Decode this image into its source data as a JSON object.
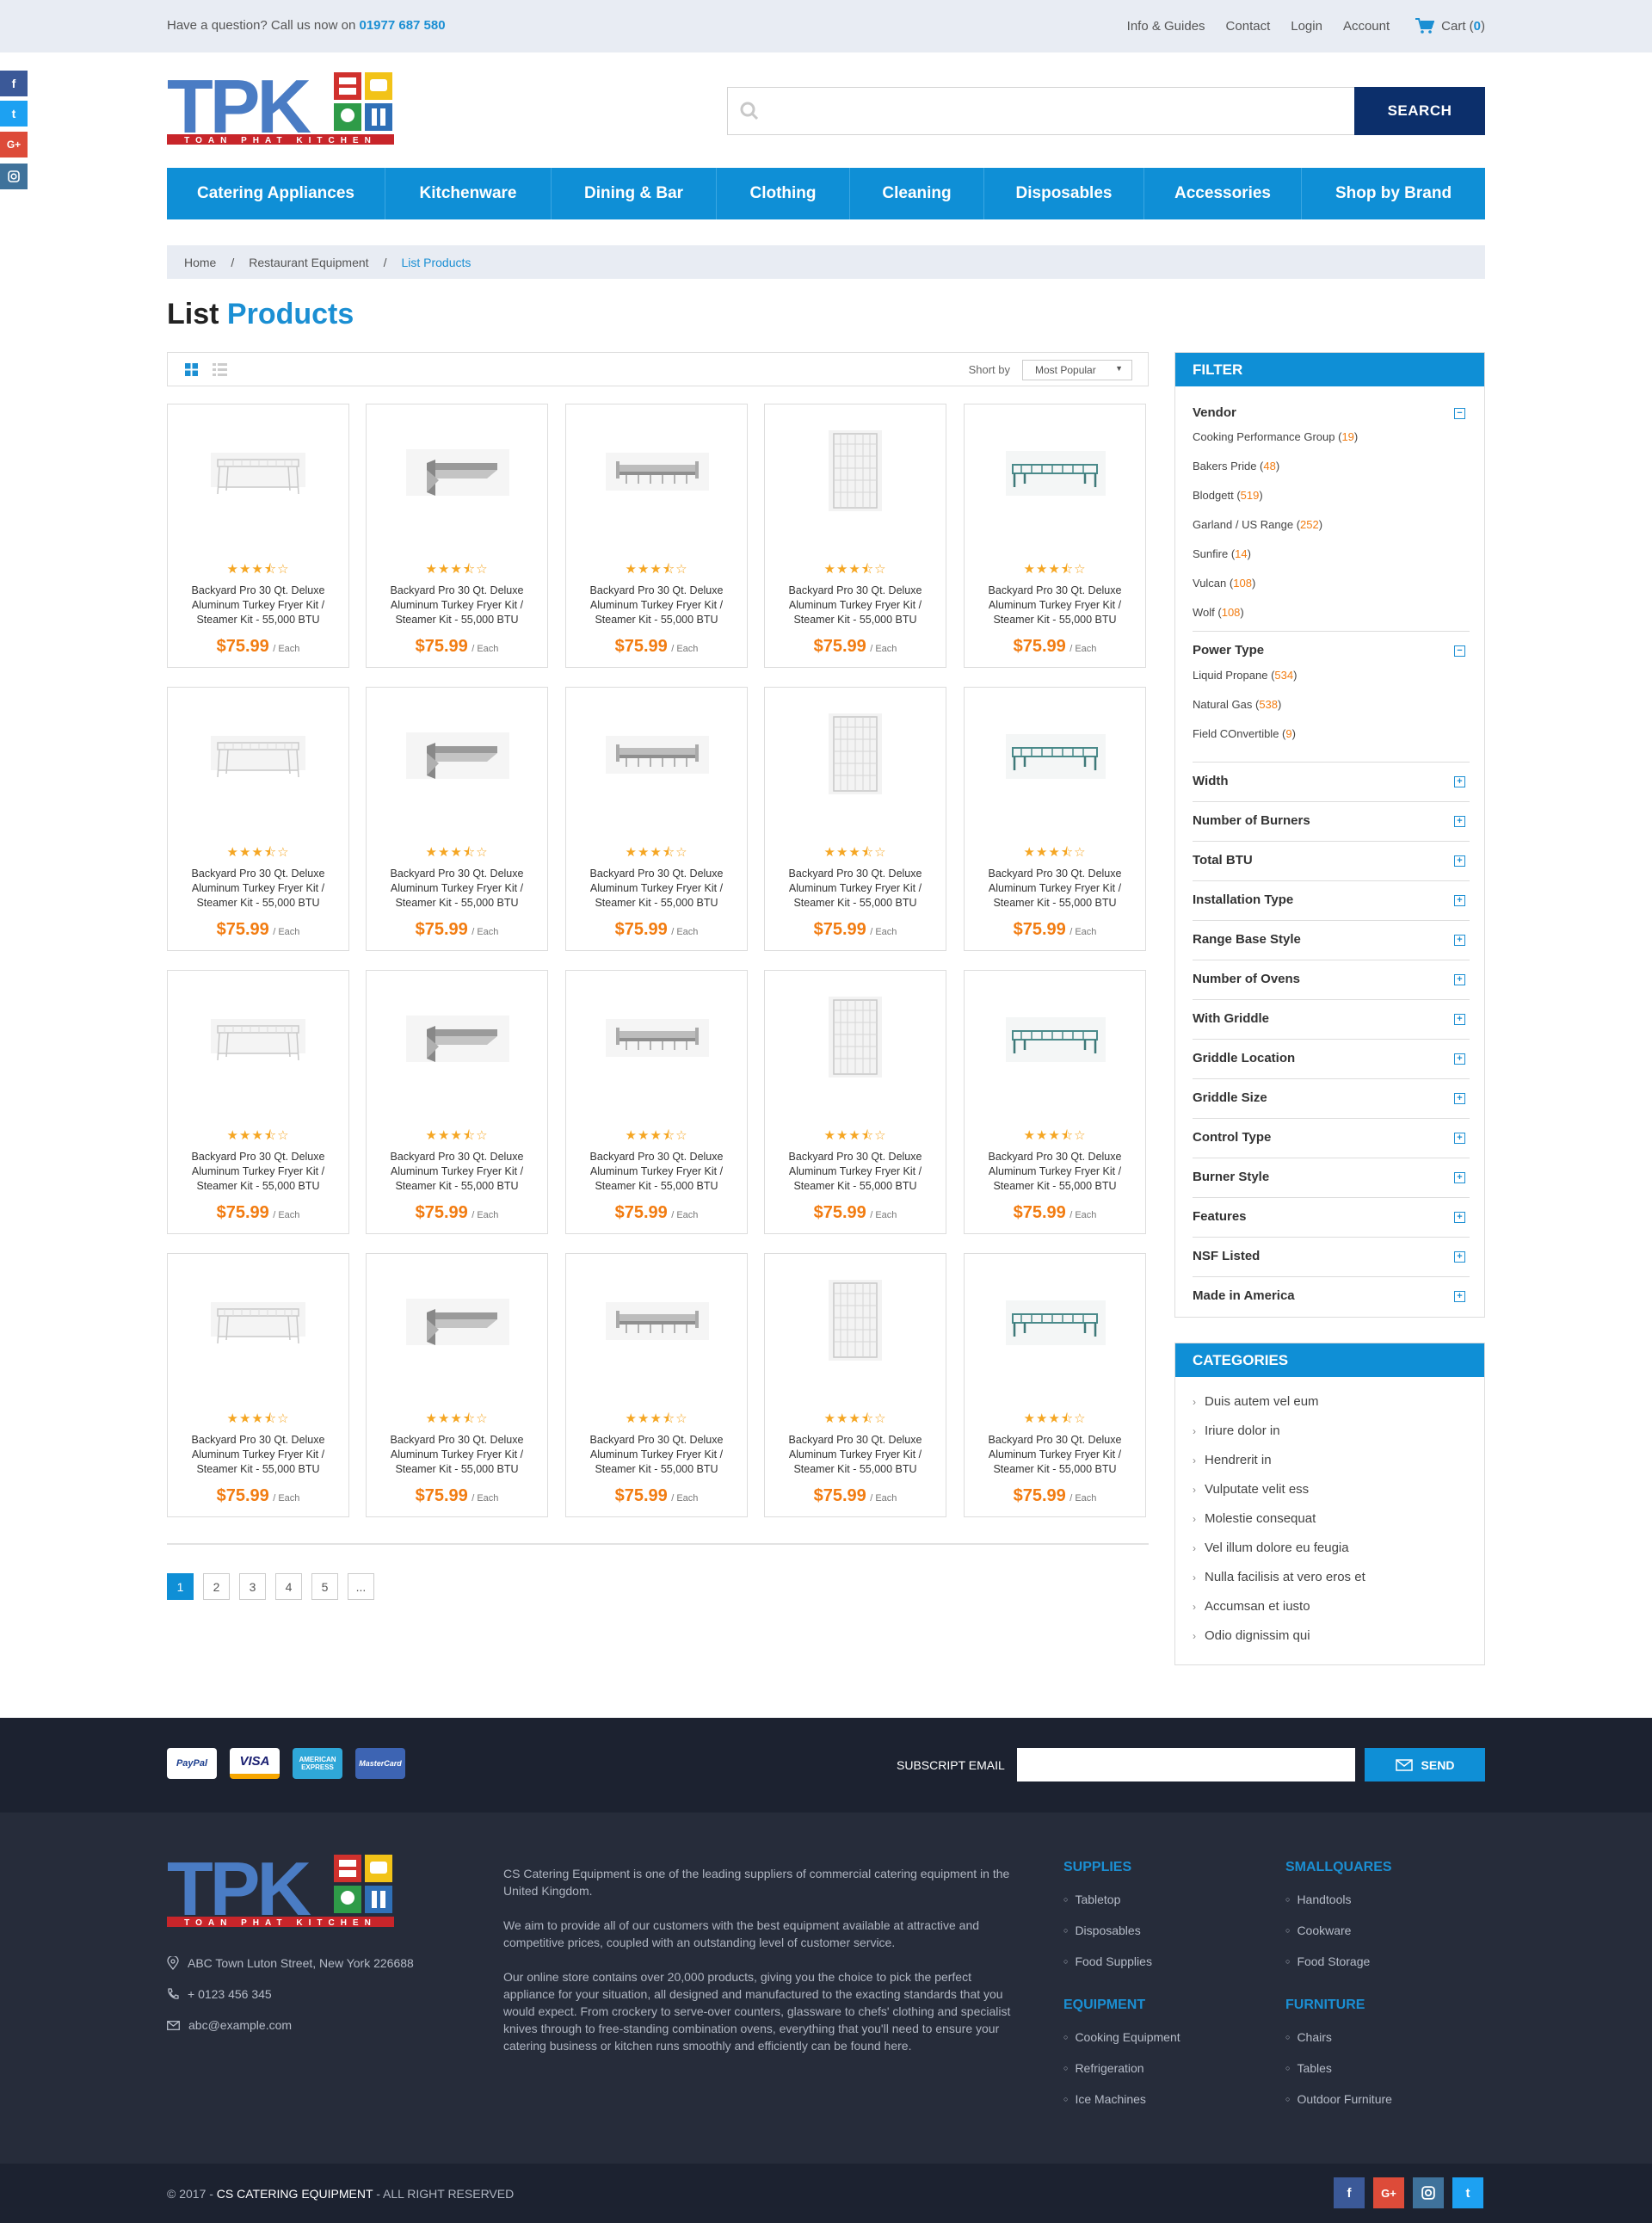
{
  "topbar": {
    "question": "Have a question? Call us now on",
    "phone": "01977 687 580",
    "links": [
      "Info & Guides",
      "Contact",
      "Login",
      "Account"
    ],
    "cart_label": "Cart (",
    "cart_count": "0",
    "cart_close": ")"
  },
  "logo": {
    "text": "TPK",
    "tagline": "TOAN PHAT KITCHEN"
  },
  "search": {
    "placeholder": "",
    "button": "SEARCH"
  },
  "nav": [
    "Catering Appliances",
    "Kitchenware",
    "Dining & Bar",
    "Clothing",
    "Cleaning",
    "Disposables",
    "Accessories",
    "Shop by Brand"
  ],
  "breadcrumb": [
    "Home",
    "Restaurant Equipment",
    "List Products"
  ],
  "page_title": {
    "first": "List",
    "second": "Products"
  },
  "toolbar": {
    "sort_label": "Short by",
    "sort_value": "Most Popular"
  },
  "product": {
    "name": "Backyard Pro 30 Qt. Deluxe Aluminum Turkey Fryer Kit / Steamer Kit - 55,000 BTU",
    "price": "$75.99",
    "unit": "/ Each",
    "rating": 3.5,
    "rating_max": 5
  },
  "pagination": [
    "1",
    "2",
    "3",
    "4",
    "5",
    "..."
  ],
  "filter": {
    "title": "FILTER",
    "vendor": {
      "title": "Vendor",
      "options": [
        {
          "label": "Cooking Performance Group",
          "count": "19"
        },
        {
          "label": "Bakers Pride",
          "count": "48"
        },
        {
          "label": "Blodgett",
          "count": "519"
        },
        {
          "label": "Garland / US Range",
          "count": "252"
        },
        {
          "label": "Sunfire",
          "count": "14"
        },
        {
          "label": "Vulcan",
          "count": "108"
        },
        {
          "label": "Wolf",
          "count": "108"
        }
      ]
    },
    "power": {
      "title": "Power Type",
      "options": [
        {
          "label": "Liquid Propane",
          "count": "534"
        },
        {
          "label": "Natural Gas",
          "count": "538"
        },
        {
          "label": "Field COnvertible",
          "count": "9"
        }
      ]
    },
    "collapsed": [
      "Width",
      "Number of Burners",
      "Total BTU",
      "Installation Type",
      "Range Base Style",
      "Number of Ovens",
      "With Griddle",
      "Griddle Location",
      "Griddle Size",
      "Control Type",
      "Burner Style",
      "Features",
      "NSF Listed",
      "Made in America"
    ]
  },
  "categories": {
    "title": "CATEGORIES",
    "items": [
      "Duis autem vel eum",
      "Iriure dolor in",
      "Hendrerit in",
      "Vulputate velit ess",
      "Molestie consequat",
      "Vel illum dolore eu feugia",
      "Nulla facilisis at vero eros et",
      "Accumsan et iusto",
      "Odio dignissim qui"
    ]
  },
  "payments": [
    "PayPal",
    "VISA",
    "AMERICAN EXPRESS",
    "MasterCard"
  ],
  "subscribe": {
    "label": "SUBSCRIPT EMAIL",
    "button": "SEND"
  },
  "footer": {
    "address": "ABC Town Luton Street, New York 226688",
    "phone": "+ 0123 456 345",
    "email": "abc@example.com",
    "desc": [
      "CS Catering Equipment is one of the leading suppliers of commercial catering equipment in the United Kingdom.",
      "We aim to provide all of our customers with the best equipment available at attractive and competitive prices, coupled with an outstanding level of customer service.",
      "Our online store contains over 20,000 products, giving you the choice to pick the perfect appliance for your situation, all designed and manufactured to the exacting standards that you would expect. From crockery to serve-over counters, glassware to chefs' clothing and specialist knives through to free-standing combination ovens, everything that you'll need to ensure your catering business or kitchen runs smoothly and efficiently can be found here."
    ],
    "cols": [
      {
        "title": "SUPPLIES",
        "items": [
          "Tabletop",
          "Disposables",
          "Food Supplies"
        ]
      },
      {
        "title": "SMALLQUARES",
        "items": [
          "Handtools",
          "Cookware",
          "Food Storage"
        ]
      },
      {
        "title": "EQUIPMENT",
        "items": [
          "Cooking Equipment",
          "Refrigeration",
          "Ice Machines"
        ]
      },
      {
        "title": "FURNITURE",
        "items": [
          "Chairs",
          "Tables",
          "Outdoor Furniture"
        ]
      }
    ],
    "copyright_pre": "© 2017 - ",
    "copyright_brand": "CS CATERING EQUIPMENT",
    "copyright_post": " - ALL RIGHT RESERVED"
  },
  "colors": {
    "accent": "#0f8fd6",
    "navy": "#0c2f6b",
    "price": "#f27c11",
    "footer": "#262c3a"
  }
}
